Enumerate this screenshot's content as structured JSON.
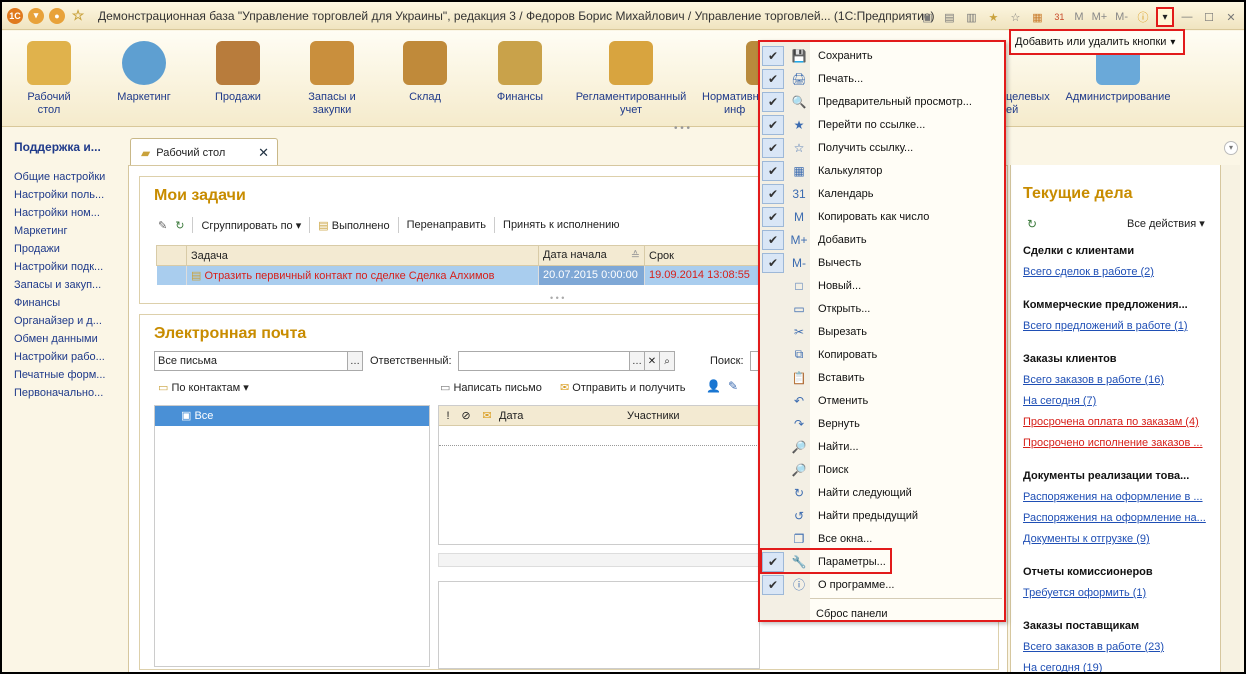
{
  "window": {
    "title": "Демонстрационная база \"Управление торговлей для Украины\", редакция 3 / Федоров Борис Михайлович / Управление торговлей...  (1С:Предприятие)",
    "app_badge": "1С",
    "mm_labels": [
      "M",
      "M+",
      "M-"
    ]
  },
  "sections": [
    {
      "label": "Рабочий\nстол",
      "l1": "Рабочий",
      "l2": "стол",
      "color": "#e0b24c"
    },
    {
      "label": "Маркетинг",
      "l1": "Маркетинг",
      "l2": "",
      "color": "#5e9fd1"
    },
    {
      "label": "Продажи",
      "l1": "Продажи",
      "l2": "",
      "color": "#b87c3c"
    },
    {
      "label": "Запасы и закупки",
      "l1": "Запасы и",
      "l2": "закупки",
      "color": "#c98f3d"
    },
    {
      "label": "Склад",
      "l1": "Склад",
      "l2": "",
      "color": "#c08a3a"
    },
    {
      "label": "Финансы",
      "l1": "Финансы",
      "l2": "",
      "color": "#c9a24a"
    },
    {
      "label": "Регламентированный учет",
      "l1": "Регламентированный",
      "l2": "учет",
      "color": "#d8a43f"
    },
    {
      "label": "Нормативн инфо",
      "l1": "Нормативн",
      "l2": "инф",
      "color": "#b98a3c"
    },
    {
      "label": "целевых ей",
      "l1": "целевых",
      "l2": "ей",
      "color": "#6ba2cf"
    },
    {
      "label": "Администрирование",
      "l1": "Администрирование",
      "l2": "",
      "color": "#6aa9d9"
    }
  ],
  "nav": {
    "title": "Поддержка и...",
    "items": [
      "Общие настройки",
      "Настройки поль...",
      "Настройки ном...",
      "Маркетинг",
      "Продажи",
      "Настройки подк...",
      "Запасы и закуп...",
      "Финансы",
      "Органайзер и д...",
      "Обмен данными",
      "Настройки рабо...",
      "Печатные форм...",
      "Первоначально..."
    ]
  },
  "tab": {
    "label": "Рабочий стол"
  },
  "tasks": {
    "title": "Мои задачи",
    "toolbar": {
      "group": "Сгруппировать по",
      "done": "Выполнено",
      "redirect": "Перенаправить",
      "accept": "Принять к исполнению"
    },
    "columns": [
      "Задача",
      "Дата начала",
      "Срок"
    ],
    "rows": [
      {
        "task": "Отразить первичный контакт по сделке Сделка Алхимов",
        "start": "20.07.2015 0:00:00",
        "due": "19.09.2014 13:08:55"
      }
    ]
  },
  "mail": {
    "title": "Электронная почта",
    "filter_value": "Все письма",
    "responsible_label": "Ответственный:",
    "search_label": "Поиск:",
    "by_contacts": "По контактам",
    "write": "Написать письмо",
    "send_receive": "Отправить и получить",
    "tree_all": "Все",
    "columns": {
      "date": "Дата",
      "participants": "Участники"
    }
  },
  "menu": {
    "items": [
      {
        "label": "Сохранить",
        "checked": true,
        "icon": "💾"
      },
      {
        "label": "Печать...",
        "checked": true,
        "icon": "🖨"
      },
      {
        "label": "Предварительный просмотр...",
        "checked": true,
        "icon": "🔍"
      },
      {
        "label": "Перейти по ссылке...",
        "checked": true,
        "icon": "★"
      },
      {
        "label": "Получить ссылку...",
        "checked": true,
        "icon": "☆"
      },
      {
        "label": "Калькулятор",
        "checked": true,
        "icon": "▦"
      },
      {
        "label": "Календарь",
        "checked": true,
        "icon": "31"
      },
      {
        "label": "Копировать как число",
        "checked": true,
        "icon": "M"
      },
      {
        "label": "Добавить",
        "checked": true,
        "icon": "M+"
      },
      {
        "label": "Вычесть",
        "checked": true,
        "icon": "M-"
      },
      {
        "label": "Новый...",
        "checked": false,
        "icon": "□"
      },
      {
        "label": "Открыть...",
        "checked": false,
        "icon": "▭"
      },
      {
        "label": "Вырезать",
        "checked": false,
        "icon": "✂"
      },
      {
        "label": "Копировать",
        "checked": false,
        "icon": "⧉"
      },
      {
        "label": "Вставить",
        "checked": false,
        "icon": "📋"
      },
      {
        "label": "Отменить",
        "checked": false,
        "icon": "↶"
      },
      {
        "label": "Вернуть",
        "checked": false,
        "icon": "↷"
      },
      {
        "label": "Найти...",
        "checked": false,
        "icon": "🔎"
      },
      {
        "label": "Поиск",
        "checked": false,
        "icon": "🔎"
      },
      {
        "label": "Найти следующий",
        "checked": false,
        "icon": "↻"
      },
      {
        "label": "Найти предыдущий",
        "checked": false,
        "icon": "↺"
      },
      {
        "label": "Все окна...",
        "checked": false,
        "icon": "❐"
      },
      {
        "label": "Параметры...",
        "checked": true,
        "icon": "🔧"
      },
      {
        "label": "О программе...",
        "checked": true,
        "icon": "ⓘ"
      }
    ],
    "reset": "Сброс панели"
  },
  "add_remove_label": "Добавить или удалить кнопки",
  "current": {
    "title": "Текущие дела",
    "all_actions": "Все действия",
    "groups": [
      {
        "name": "Сделки с клиентами",
        "links": [
          {
            "text": "Всего сделок в работе (2)",
            "red": false
          }
        ]
      },
      {
        "name": "Коммерческие предложения...",
        "links": [
          {
            "text": "Всего предложений в работе (1)",
            "red": false
          }
        ]
      },
      {
        "name": "Заказы клиентов",
        "links": [
          {
            "text": "Всего заказов в работе (16)",
            "red": false
          },
          {
            "text": "На сегодня (7)",
            "red": false
          },
          {
            "text": "Просрочена оплата по заказам (4)",
            "red": true
          },
          {
            "text": "Просрочено исполнение заказов ...",
            "red": true
          }
        ]
      },
      {
        "name": "Документы реализации това...",
        "links": [
          {
            "text": "Распоряжения на оформление в ...",
            "red": false
          },
          {
            "text": "Распоряжения на оформление на...",
            "red": false
          },
          {
            "text": "Документы к отгрузке (9)",
            "red": false
          }
        ]
      },
      {
        "name": "Отчеты комиссионеров",
        "links": [
          {
            "text": "Требуется оформить (1)",
            "red": false
          }
        ]
      },
      {
        "name": "Заказы поставщикам",
        "links": [
          {
            "text": "Всего заказов в работе (23)",
            "red": false
          },
          {
            "text": "На сегодня (19)",
            "red": false
          }
        ]
      }
    ]
  }
}
